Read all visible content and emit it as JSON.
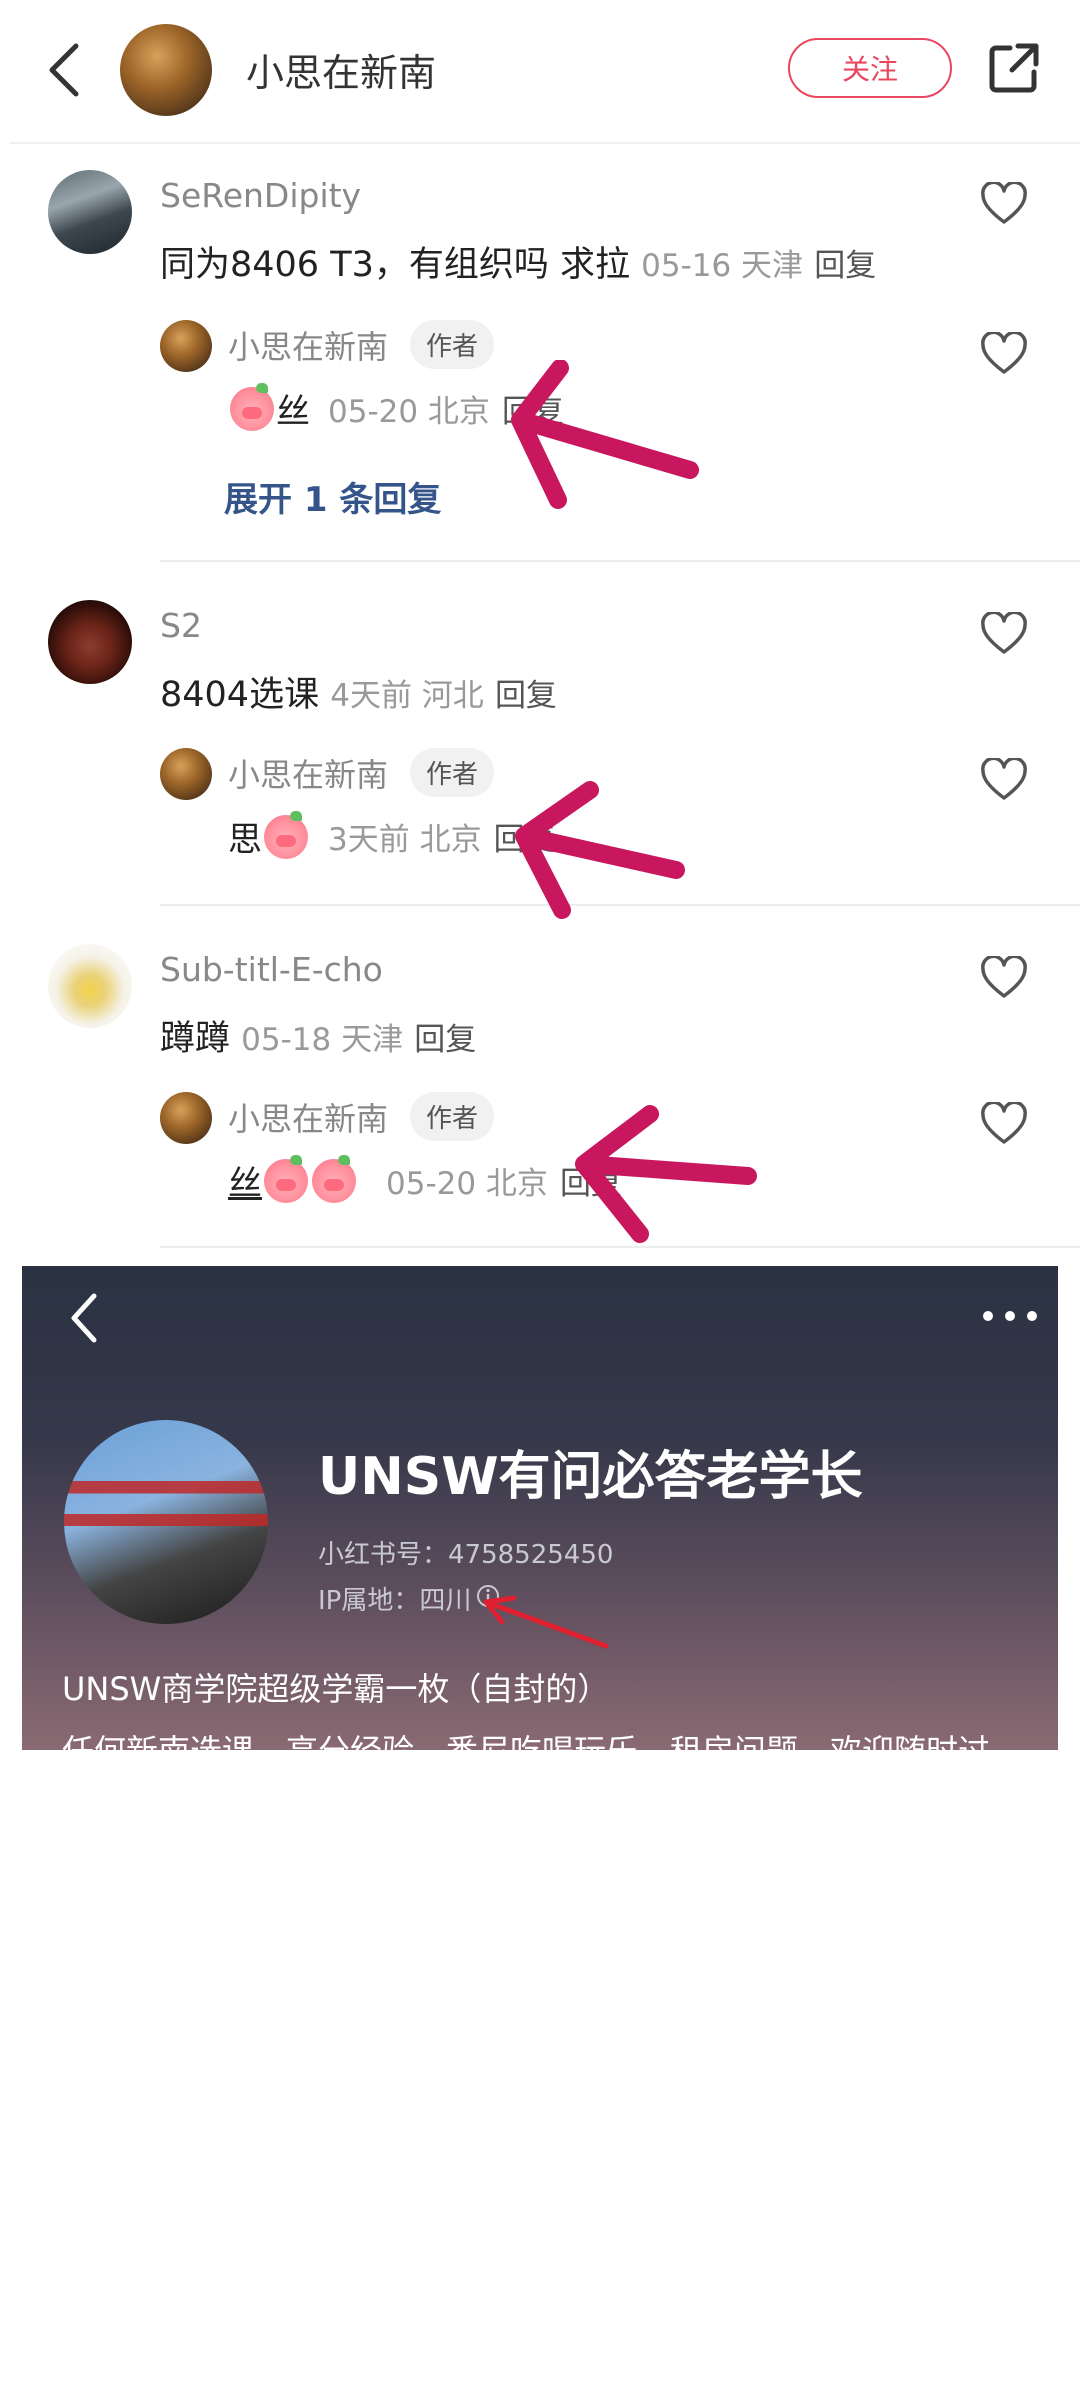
{
  "header": {
    "title": "小思在新南",
    "follow_label": "关注"
  },
  "comments": [
    {
      "username": "SeRenDipity",
      "text": "同为8406 T3，有组织吗 求拉",
      "meta": "05-16 天津",
      "reply_label": "回复",
      "reply": {
        "username": "小思在新南",
        "badge": "作者",
        "text": "丝",
        "meta": "05-20 北京",
        "reply_label": "回复"
      },
      "expand_label": "展开 1 条回复"
    },
    {
      "username": "S2",
      "text": "8404选课",
      "meta": "4天前  河北",
      "reply_label": "回复",
      "reply": {
        "username": "小思在新南",
        "badge": "作者",
        "text": "思",
        "meta": "3天前  北京",
        "reply_label": "回复"
      }
    },
    {
      "username": "Sub-titl-E-cho",
      "text": "蹲蹲",
      "meta": "05-18 天津",
      "reply_label": "回复",
      "reply": {
        "username": "小思在新南",
        "badge": "作者",
        "text": "丝",
        "meta": "05-20 北京",
        "reply_label": "回复"
      }
    }
  ],
  "profile": {
    "name": "UNSW有问必答老学长",
    "id_line": "小红书号：4758525450",
    "ip_line": "IP属地：四川",
    "bio_line1": "UNSW商学院超级学霸一枚（自封的）",
    "bio_line2": "任何新南选课、高分经验、悉尼吃喝玩乐、租房问题，欢迎随时过"
  },
  "colors": {
    "accent": "#e8475f",
    "link": "#35558a",
    "annotation_arrow": "#c8175f"
  },
  "icons": {
    "back": "chevron-left-icon",
    "share": "share-icon",
    "like": "heart-outline-icon",
    "more": "more-dots-icon",
    "info": "info-icon",
    "emoji": "pig-emoji-icon"
  }
}
